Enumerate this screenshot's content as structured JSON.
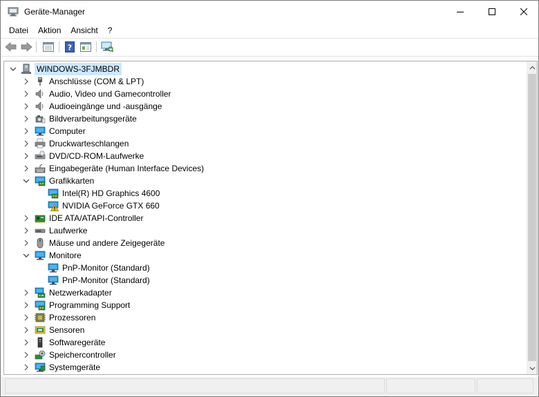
{
  "window": {
    "title": "Geräte-Manager"
  },
  "menu": [
    {
      "label": "Datei"
    },
    {
      "label": "Aktion"
    },
    {
      "label": "Ansicht"
    },
    {
      "label": "?"
    }
  ],
  "toolbar": {
    "buttons": [
      "back-icon",
      "forward-icon",
      "properties-pane-icon",
      "help-icon",
      "show-hidden-icon",
      "scan-hardware-icon"
    ]
  },
  "tree": {
    "root": {
      "label": "WINDOWS-3FJMBDR",
      "expanded": true,
      "selected": true,
      "icon": "computer-root-icon"
    },
    "rows": [
      {
        "label": "Anschlüsse (COM & LPT)",
        "level": 1,
        "expander": "collapsed",
        "icon": "port-icon"
      },
      {
        "label": "Audio, Video und Gamecontroller",
        "level": 1,
        "expander": "collapsed",
        "icon": "speaker-icon"
      },
      {
        "label": "Audioeingänge und -ausgänge",
        "level": 1,
        "expander": "collapsed",
        "icon": "speaker-icon"
      },
      {
        "label": "Bildverarbeitungsgeräte",
        "level": 1,
        "expander": "collapsed",
        "icon": "camera-icon"
      },
      {
        "label": "Computer",
        "level": 1,
        "expander": "collapsed",
        "icon": "monitor-icon"
      },
      {
        "label": "Druckwarteschlangen",
        "level": 1,
        "expander": "collapsed",
        "icon": "printer-icon"
      },
      {
        "label": "DVD/CD-ROM-Laufwerke",
        "level": 1,
        "expander": "collapsed",
        "icon": "dvd-drive-icon"
      },
      {
        "label": "Eingabegeräte (Human Interface Devices)",
        "level": 1,
        "expander": "collapsed",
        "icon": "hid-icon"
      },
      {
        "label": "Grafikkarten",
        "level": 1,
        "expander": "expanded",
        "icon": "display-adapter-icon"
      },
      {
        "label": "Intel(R) HD Graphics 4600",
        "level": 2,
        "expander": "none",
        "icon": "display-adapter-icon"
      },
      {
        "label": "NVIDIA GeForce GTX 660",
        "level": 2,
        "expander": "none",
        "icon": "display-adapter-warning-icon"
      },
      {
        "label": "IDE ATA/ATAPI-Controller",
        "level": 1,
        "expander": "collapsed",
        "icon": "ide-controller-icon"
      },
      {
        "label": "Laufwerke",
        "level": 1,
        "expander": "collapsed",
        "icon": "disk-drive-icon"
      },
      {
        "label": "Mäuse und andere Zeigegeräte",
        "level": 1,
        "expander": "collapsed",
        "icon": "mouse-icon"
      },
      {
        "label": "Monitore",
        "level": 1,
        "expander": "expanded",
        "icon": "monitor-icon"
      },
      {
        "label": "PnP-Monitor (Standard)",
        "level": 2,
        "expander": "none",
        "icon": "monitor-icon"
      },
      {
        "label": "PnP-Monitor (Standard)",
        "level": 2,
        "expander": "none",
        "icon": "monitor-icon"
      },
      {
        "label": "Netzwerkadapter",
        "level": 1,
        "expander": "collapsed",
        "icon": "network-adapter-icon"
      },
      {
        "label": "Programming Support",
        "level": 1,
        "expander": "collapsed",
        "icon": "display-adapter-icon"
      },
      {
        "label": "Prozessoren",
        "level": 1,
        "expander": "collapsed",
        "icon": "processor-icon"
      },
      {
        "label": "Sensoren",
        "level": 1,
        "expander": "collapsed",
        "icon": "sensor-icon"
      },
      {
        "label": "Softwaregeräte",
        "level": 1,
        "expander": "collapsed",
        "icon": "software-device-icon"
      },
      {
        "label": "Speichercontroller",
        "level": 1,
        "expander": "collapsed",
        "icon": "storage-controller-icon"
      },
      {
        "label": "Systemgeräte",
        "level": 1,
        "expander": "collapsed",
        "icon": "system-device-icon"
      }
    ]
  },
  "colors": {
    "selection": "#cce8ff",
    "monitor_blue": "#1e8fd6",
    "warning_yellow": "#f5c400"
  }
}
